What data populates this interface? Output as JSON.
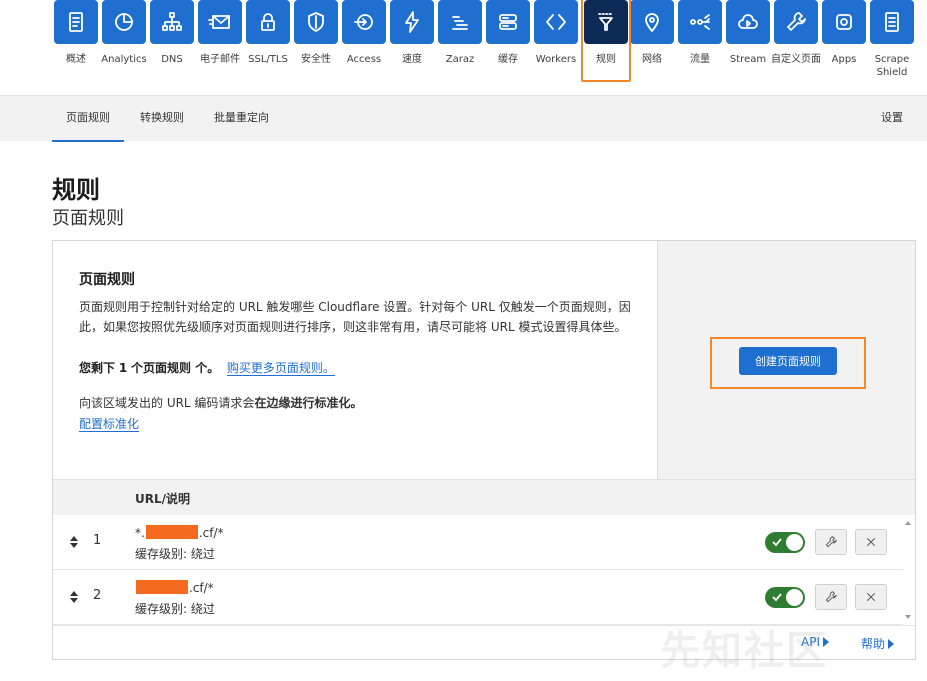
{
  "nav": {
    "items": [
      {
        "label": "概述",
        "icon": "doc-icon"
      },
      {
        "label": "Analytics",
        "icon": "pie-chart-icon"
      },
      {
        "label": "DNS",
        "icon": "network-icon"
      },
      {
        "label": "电子邮件",
        "icon": "mail-icon"
      },
      {
        "label": "SSL/TLS",
        "icon": "lock-icon"
      },
      {
        "label": "安全性",
        "icon": "shield-icon"
      },
      {
        "label": "Access",
        "icon": "access-icon"
      },
      {
        "label": "速度",
        "icon": "bolt-icon"
      },
      {
        "label": "Zaraz",
        "icon": "zaraz-icon"
      },
      {
        "label": "缓存",
        "icon": "storage-icon"
      },
      {
        "label": "Workers",
        "icon": "code-icon"
      },
      {
        "label": "规则",
        "icon": "filter-icon"
      },
      {
        "label": "网络",
        "icon": "pin-icon"
      },
      {
        "label": "流量",
        "icon": "traffic-icon"
      },
      {
        "label": "Stream",
        "icon": "cloud-play-icon"
      },
      {
        "label": "自定义页面",
        "icon": "wrench-icon"
      },
      {
        "label": "Apps",
        "icon": "apps-icon"
      },
      {
        "label": "Scrape Shield",
        "icon": "page-icon"
      }
    ],
    "active_index": 11
  },
  "subtabs": {
    "items": [
      "页面规则",
      "转换规则",
      "批量重定向"
    ],
    "settings": "设置"
  },
  "heading": {
    "title": "规则",
    "subtitle": "页面规则"
  },
  "card": {
    "title": "页面规则",
    "description": "页面规则用于控制针对给定的 URL 触发哪些 Cloudflare 设置。针对每个 URL 仅触发一个页面规则，因此，如果您按照优先级顺序对页面规则进行排序，则这非常有用，请尽可能将 URL 模式设置得具体些。",
    "quota_prefix": "您剩下",
    "quota_count": "1",
    "quota_suffix": "个页面规则 个。",
    "buy_more": "购买更多页面规则。",
    "normalize_prefix": "向该区域发出的 URL 编码请求会",
    "normalize_bold": "在边缘进行标准化。",
    "normalize_link": "配置标准化",
    "create_button": "创建页面规则"
  },
  "table": {
    "header_url": "URL/说明",
    "rows": [
      {
        "num": "1",
        "url_prefix": "*.",
        "url_suffix": ".cf/*",
        "cache": "缓存级别: 绕过",
        "enabled": true
      },
      {
        "num": "2",
        "url_prefix": "",
        "url_suffix": ".cf/*",
        "cache": "缓存级别: 绕过",
        "enabled": true
      }
    ]
  },
  "footer": {
    "api": "API",
    "help": "帮助"
  },
  "watermark": "先知社区",
  "colors": {
    "accent": "#1f6fd0",
    "active_tile": "#0b2a55",
    "highlight": "#f5862a",
    "toggle_on": "#2e7d32",
    "redaction": "#f56a1e"
  }
}
